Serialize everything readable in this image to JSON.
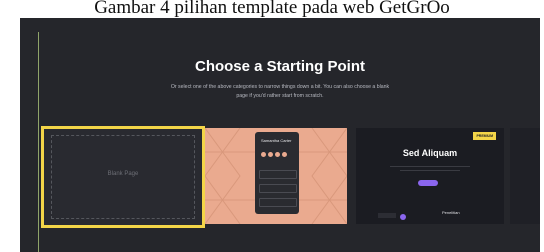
{
  "caption": "Gambar 4 pilihan template pada web GetGrOo",
  "heading": "Choose a Starting Point",
  "subtitle": "Or select one of the above categories to narrow things down a bit. You can also choose a blank page if you'd rather start from scratch.",
  "cards": {
    "blank": {
      "label": "Blank Page"
    },
    "profile": {
      "name": "Samantha Carter"
    },
    "dark": {
      "badge": "PREMIUM",
      "heading": "Sed Aliquam",
      "footer": "Penelitian"
    }
  },
  "colors": {
    "background": "#25262b",
    "accent_yellow": "#f3d548",
    "peach": "#eaaa8f",
    "purple": "#8b66ee"
  }
}
